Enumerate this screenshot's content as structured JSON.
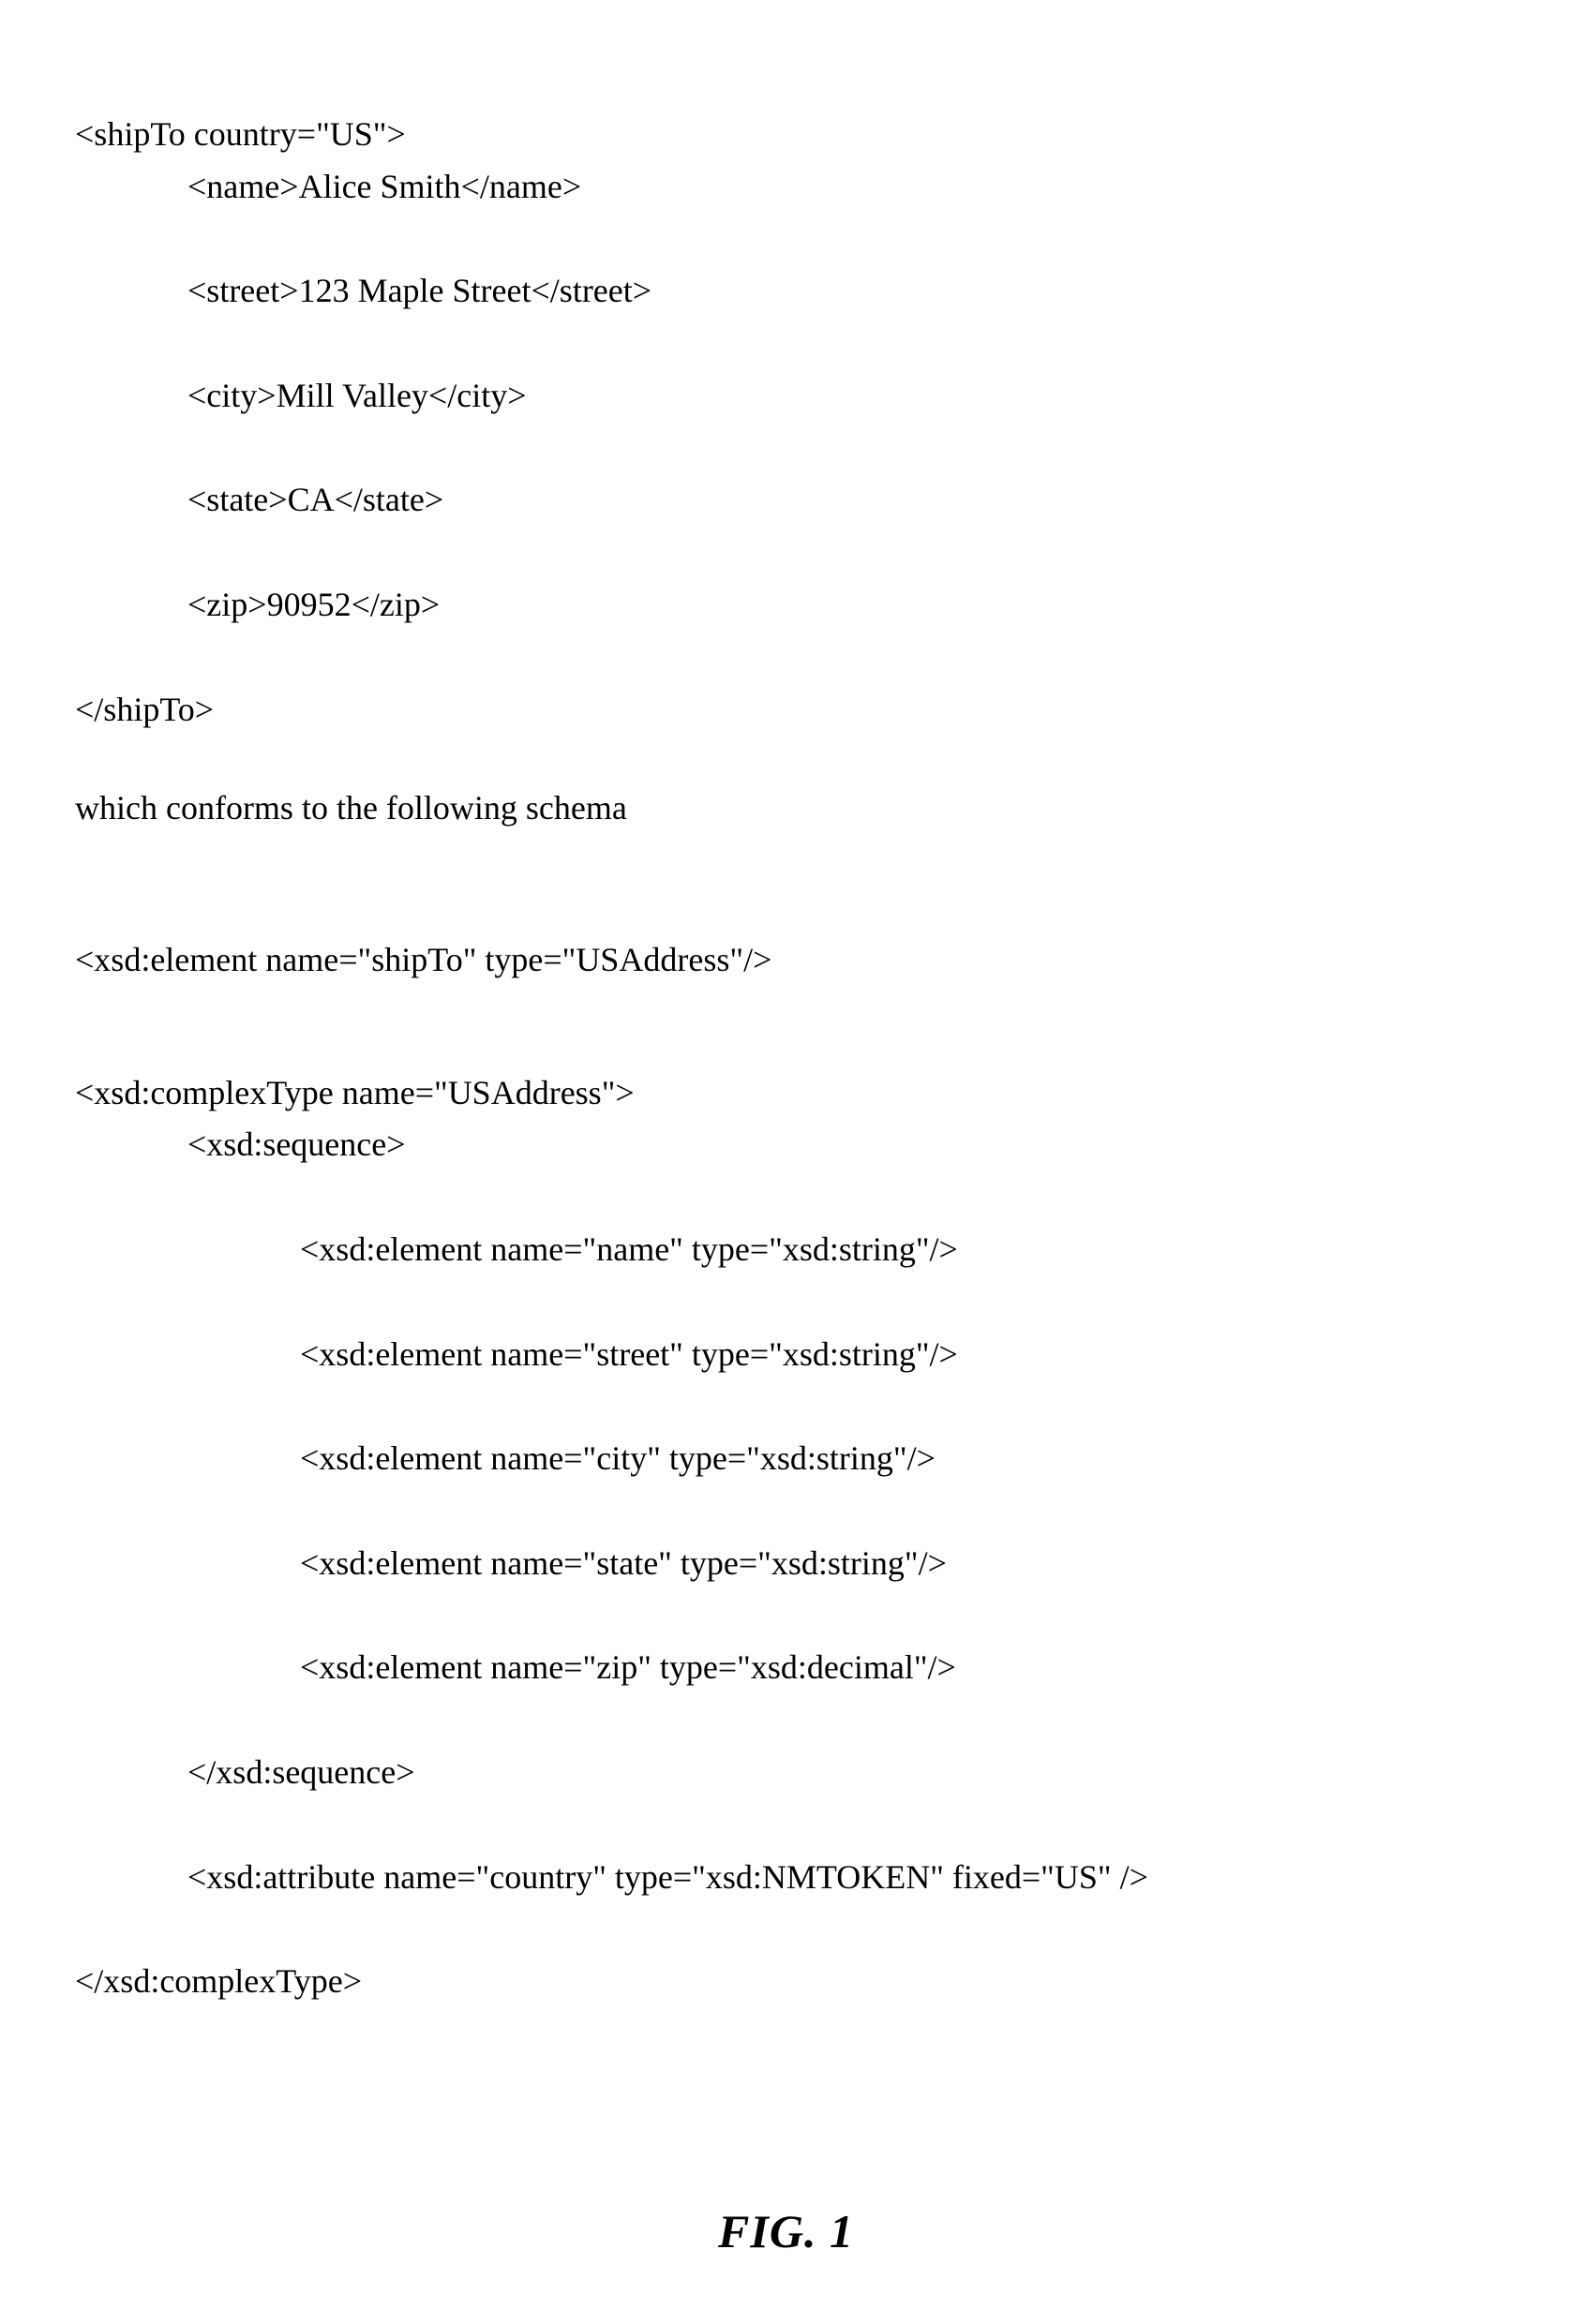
{
  "xml": {
    "open": "<shipTo country=\"US\">",
    "name": "<name>Alice Smith</name>",
    "street": "<street>123 Maple Street</street>",
    "city": "<city>Mill Valley</city>",
    "state": "<state>CA</state>",
    "zip": "<zip>90952</zip>",
    "close": "</shipTo>"
  },
  "conform_text": "which conforms to the following schema",
  "schema": {
    "elementDecl": "<xsd:element name=\"shipTo\" type=\"USAddress\"/>",
    "complexOpen": "<xsd:complexType name=\"USAddress\">",
    "seqOpen": "<xsd:sequence>",
    "elName": "<xsd:element name=\"name\" type=\"xsd:string\"/>",
    "elStreet": "<xsd:element name=\"street\" type=\"xsd:string\"/>",
    "elCity": "<xsd:element name=\"city\" type=\"xsd:string\"/>",
    "elState": "<xsd:element name=\"state\" type=\"xsd:string\"/>",
    "elZip": "<xsd:element name=\"zip\" type=\"xsd:decimal\"/>",
    "seqClose": "</xsd:sequence>",
    "attr": "<xsd:attribute name=\"country\" type=\"xsd:NMTOKEN\" fixed=\"US\" />",
    "complexClose": "</xsd:complexType>"
  },
  "figure_label": "FIG.  1"
}
